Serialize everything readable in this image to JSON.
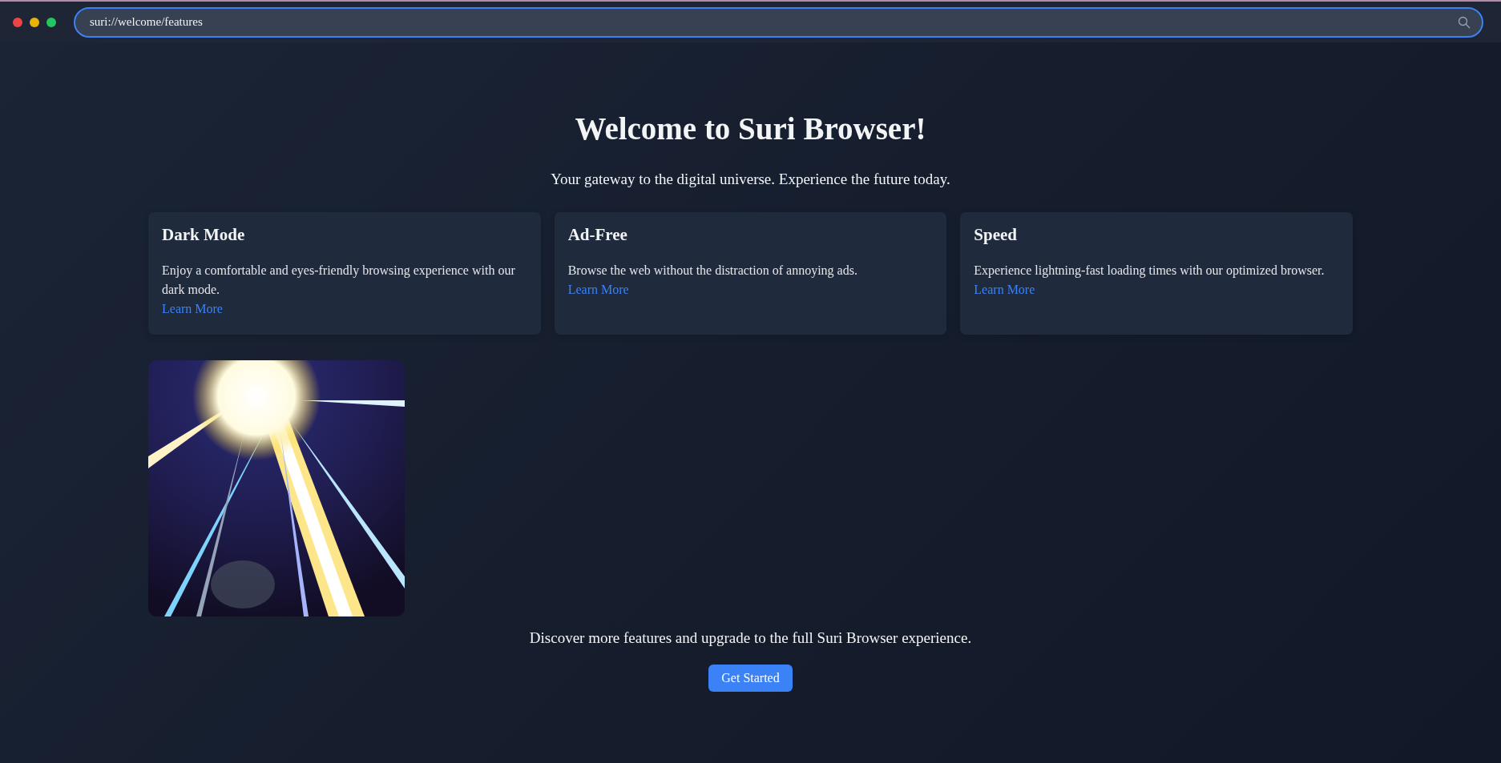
{
  "address_bar": {
    "value": "suri://welcome/features"
  },
  "window_controls": [
    {
      "color": "#ef4444"
    },
    {
      "color": "#eab308"
    },
    {
      "color": "#22c55e"
    }
  ],
  "heading": "Welcome to Suri Browser!",
  "tagline": "Your gateway to the digital universe. Experience the future today.",
  "features": [
    {
      "title": "Dark Mode",
      "text": "Enjoy a comfortable and eyes-friendly browsing experience with our dark mode.",
      "link": "Learn More"
    },
    {
      "title": "Ad-Free",
      "text": "Browse the web without the distraction of annoying ads.",
      "link": "Learn More"
    },
    {
      "title": "Speed",
      "text": "Experience lightning-fast loading times with our optimized browser.",
      "link": "Learn More"
    }
  ],
  "footer_text": "Discover more features and upgrade to the full Suri Browser experience.",
  "cta_button": "Get Started"
}
